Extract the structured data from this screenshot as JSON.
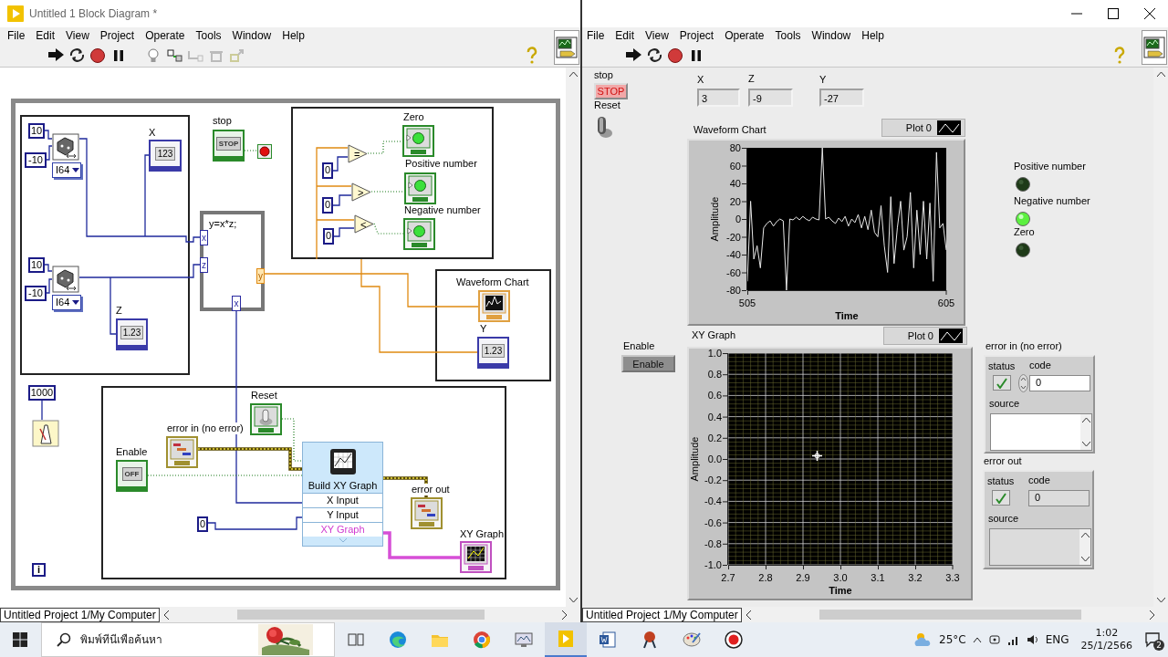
{
  "block_diagram_window": {
    "title": "Untitled 1 Block Diagram *",
    "menu": [
      "File",
      "Edit",
      "View",
      "Project",
      "Operate",
      "Tools",
      "Window",
      "Help"
    ],
    "status_bar": "Untitled Project 1/My Computer",
    "diagram": {
      "nodes": [
        {
          "kind": "constant",
          "text": "10"
        },
        {
          "kind": "constant",
          "text": "-10"
        },
        {
          "kind": "random"
        },
        {
          "kind": "representation",
          "text": "I64"
        },
        {
          "kind": "label",
          "text": "X"
        },
        {
          "kind": "indicator",
          "text": "123"
        },
        {
          "kind": "constant",
          "text": "10"
        },
        {
          "kind": "constant",
          "text": "-10"
        },
        {
          "kind": "random"
        },
        {
          "kind": "representation",
          "text": "I64"
        },
        {
          "kind": "label",
          "text": "Z"
        },
        {
          "kind": "indicator",
          "text": "1.23"
        },
        {
          "kind": "label",
          "text": "stop"
        },
        {
          "kind": "boolean",
          "text": "STOP"
        },
        {
          "kind": "stop-terminal"
        },
        {
          "kind": "formula",
          "text": "y=x*z;"
        },
        {
          "kind": "input-terminal",
          "text": "x"
        },
        {
          "kind": "input-terminal",
          "text": "z"
        },
        {
          "kind": "output-terminal",
          "text": "y"
        },
        {
          "kind": "input-terminal",
          "text": "x"
        },
        {
          "kind": "label",
          "text": "Zero"
        },
        {
          "kind": "led-terminal"
        },
        {
          "kind": "comparison",
          "text": "="
        },
        {
          "kind": "constant",
          "text": "0"
        },
        {
          "kind": "label",
          "text": "Positive number"
        },
        {
          "kind": "led-terminal"
        },
        {
          "kind": "comparison",
          "text": ">"
        },
        {
          "kind": "constant",
          "text": "0"
        },
        {
          "kind": "label",
          "text": "Negative number"
        },
        {
          "kind": "led-terminal"
        },
        {
          "kind": "comparison",
          "text": "<"
        },
        {
          "kind": "constant",
          "text": "0"
        },
        {
          "kind": "label",
          "text": "Waveform Chart"
        },
        {
          "kind": "chart-terminal"
        },
        {
          "kind": "label",
          "text": "Y"
        },
        {
          "kind": "indicator",
          "text": "1.23"
        },
        {
          "kind": "constant",
          "text": "1000"
        },
        {
          "kind": "timer"
        },
        {
          "kind": "loop-index",
          "text": "i"
        },
        {
          "kind": "label",
          "text": "Reset"
        },
        {
          "kind": "toggle-terminal"
        },
        {
          "kind": "label",
          "text": "error in (no error)"
        },
        {
          "kind": "cluster-terminal"
        },
        {
          "kind": "label",
          "text": "Enable"
        },
        {
          "kind": "boolean",
          "text": "OFF"
        },
        {
          "kind": "express",
          "text": "Build XY Graph",
          "rows": [
            {
              "kind": "input",
              "text": "X Input"
            },
            {
              "kind": "input",
              "text": "Y Input"
            },
            {
              "kind": "output",
              "text": "XY Graph"
            }
          ]
        },
        {
          "kind": "label",
          "text": "error out"
        },
        {
          "kind": "cluster-terminal"
        },
        {
          "kind": "constant",
          "text": "0"
        },
        {
          "kind": "label",
          "text": "XY Graph"
        },
        {
          "kind": "graph-terminal"
        }
      ]
    }
  },
  "front_panel_window": {
    "menu": [
      "File",
      "Edit",
      "View",
      "Project",
      "Operate",
      "Tools",
      "Window",
      "Help"
    ],
    "status_bar": "Untitled Project 1/My Computer",
    "panel": {
      "stop": {
        "label": "stop",
        "text": "STOP"
      },
      "reset": {
        "label": "Reset",
        "on": false
      },
      "numerics": [
        {
          "label": "X",
          "value": "3"
        },
        {
          "label": "Z",
          "value": "-9"
        },
        {
          "label": "Y",
          "value": "-27"
        }
      ],
      "waveform_chart": {
        "title": "Waveform Chart",
        "legend": "Plot 0",
        "ylabel": "Amplitude",
        "xlabel": "Time",
        "yticks": [
          "80",
          "60",
          "40",
          "20",
          "0",
          "-20",
          "-40",
          "-60",
          "-80"
        ],
        "xticks": [
          "505",
          "605"
        ]
      },
      "leds": [
        {
          "label": "Positive number",
          "on": false
        },
        {
          "label": "Negative number",
          "on": true
        },
        {
          "label": "Zero",
          "on": false
        }
      ],
      "enable": {
        "label": "Enable",
        "text": "Enable"
      },
      "xy_graph": {
        "title": "XY Graph",
        "legend": "Plot 0",
        "ylabel": "Amplitude",
        "xlabel": "Time",
        "yticks": [
          "1.0",
          "0.8",
          "0.6",
          "0.4",
          "0.2",
          "0.0",
          "-0.2",
          "-0.4",
          "-0.6",
          "-0.8",
          "-1.0"
        ],
        "xticks": [
          "2.7",
          "2.8",
          "2.9",
          "3.0",
          "3.1",
          "3.2",
          "3.3"
        ]
      },
      "error_clusters": [
        {
          "kind": "control",
          "label": "error in (no error)",
          "status_label": "status",
          "code_label": "code",
          "code": "0",
          "source_label": "source"
        },
        {
          "kind": "indicator",
          "label": "error out",
          "status_label": "status",
          "code_label": "code",
          "code": "0",
          "source_label": "source"
        }
      ]
    }
  },
  "taskbar": {
    "search_placeholder": "พิมพ์ที่นี่เพื่อค้นหา",
    "apps": [
      {
        "selected": false
      },
      {
        "selected": false
      },
      {
        "selected": false
      },
      {
        "selected": false
      },
      {
        "selected": false
      },
      {
        "selected": true
      },
      {
        "selected": false
      },
      {
        "selected": false
      },
      {
        "selected": false
      },
      {
        "selected": false
      }
    ],
    "temperature": "25°C",
    "language": "ENG",
    "time": "1:02",
    "date": "25/1/2566",
    "notification_count": "2"
  }
}
